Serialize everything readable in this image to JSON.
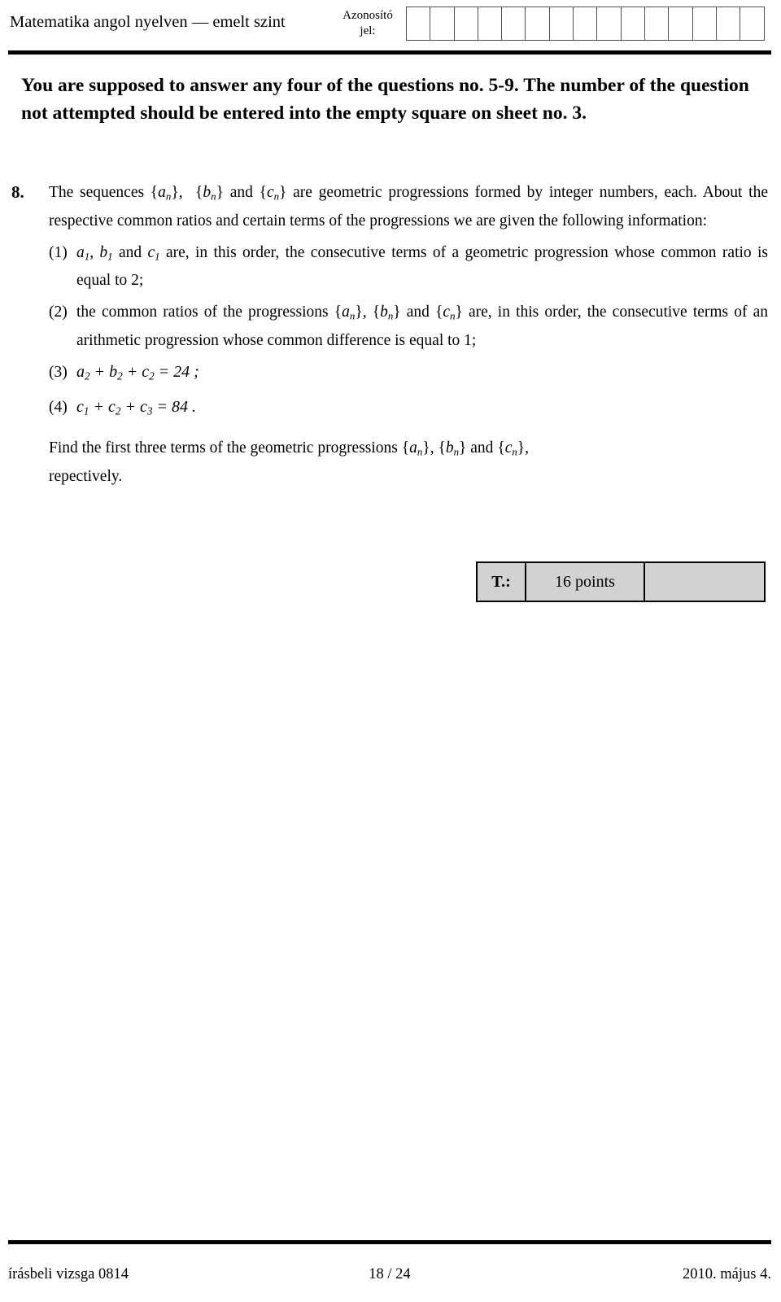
{
  "header": {
    "title": "Matematika angol nyelven — emelt szint",
    "id_label_line1": "Azonosító",
    "id_label_line2": "jel:",
    "id_cell_count": 15
  },
  "instruction": {
    "text": "You are supposed to answer any four of the questions no. 5-9. The number of the question not attempted should be entered into the empty square on sheet no. 3."
  },
  "question": {
    "number": "8.",
    "intro_part1": "The sequences ",
    "seq_a": "{a",
    "seq_a_sub": "n",
    "seq_a_close": "},",
    "seq_b": "{b",
    "seq_b_sub": "n",
    "seq_b_close": "}",
    "and_word": "and",
    "seq_c": "{c",
    "seq_c_sub": "n",
    "seq_c_close": "}",
    "intro_part2": "are geometric progressions formed by integer numbers, each. About the respective common ratios and certain terms of the progressions we are given the following information:",
    "items": [
      {
        "label": "(1)",
        "text_a": "a",
        "sub_a": "1",
        "text_b": "b",
        "sub_b": "1",
        "text_c": "c",
        "sub_c": "1",
        "body": "are, in this order, the consecutive terms of a geometric progression whose common ratio is equal to 2;"
      },
      {
        "label": "(2)",
        "lead": "the common ratios of the progressions",
        "body": "are, in this order, the consecutive terms of an arithmetic progression whose common difference is equal to 1;"
      },
      {
        "label": "(3)",
        "equation": "a₂ + b₂ + c₂ = 24 ;",
        "lhs_terms": [
          "a",
          "b",
          "c"
        ],
        "lhs_sub": "2",
        "rhs": "24"
      },
      {
        "label": "(4)",
        "equation": "c₁ + c₂ + c₃ = 84 .",
        "lhs_var": "c",
        "lhs_subs": [
          "1",
          "2",
          "3"
        ],
        "rhs": "84"
      }
    ],
    "final_part1": "Find the first three terms of the geometric progressions",
    "final_part2": "repectively."
  },
  "points_table": {
    "label": "T.:",
    "value": "16 points",
    "blank": ""
  },
  "footer": {
    "left": "írásbeli vizsga 0814",
    "center": "18 / 24",
    "right": "2010. május 4."
  },
  "colors": {
    "text": "#000000",
    "rule": "#000000",
    "grid_border": "#4d4d4d",
    "points_fill": "#d2d2d2"
  }
}
